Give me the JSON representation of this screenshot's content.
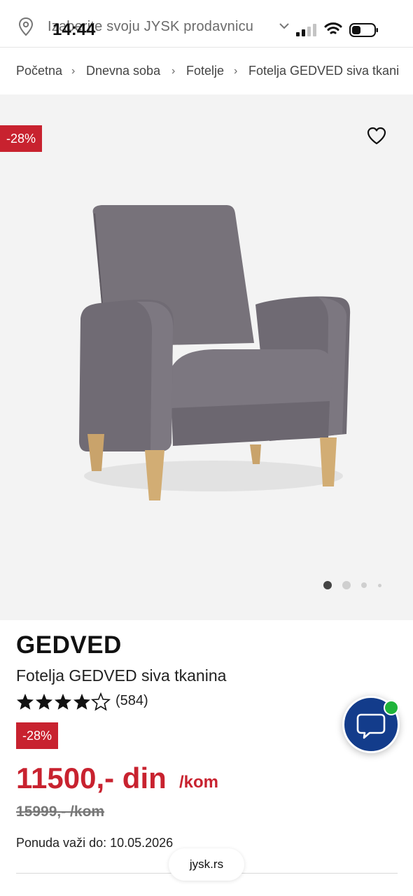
{
  "status_bar": {
    "time": "14:44"
  },
  "store_bar": {
    "text": "Izaberite svoju JYSK prodavnicu",
    "icon": "location-pin-icon"
  },
  "breadcrumb": {
    "items": [
      "Početna",
      "Dnevna soba",
      "Fotelje",
      "Fotelja GEDVED siva tkani"
    ],
    "separator": "›"
  },
  "gallery": {
    "discount_badge": "-28%",
    "active_dot": 1,
    "dot_count": 4
  },
  "product": {
    "brand": "GEDVED",
    "name": "Fotelja GEDVED siva tkanina",
    "rating": 4,
    "rating_max": 5,
    "review_count": "(584)",
    "discount_badge": "-28%",
    "price": "11500,- din",
    "price_unit": "/kom",
    "old_price": "15999,- /kom",
    "offer_valid": "Ponuda važi do: 10.05.2026"
  },
  "browser": {
    "url": "jysk.rs"
  },
  "colors": {
    "accent_red": "#c8222f",
    "chat_blue": "#133c8b",
    "online_green": "#1fb43a"
  }
}
